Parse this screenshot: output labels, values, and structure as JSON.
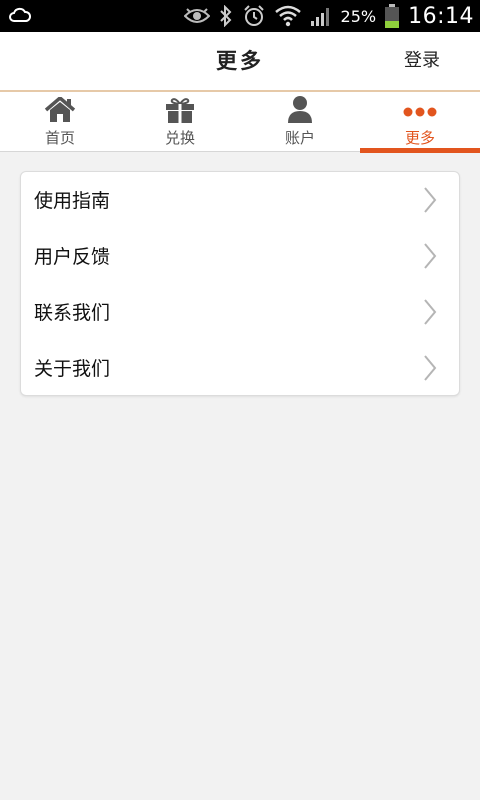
{
  "status_bar": {
    "battery_percent": "25%",
    "time": "16:14"
  },
  "header": {
    "title": "更多",
    "login_label": "登录"
  },
  "tabs": [
    {
      "label": "首页",
      "icon": "home-icon",
      "active": false
    },
    {
      "label": "兑换",
      "icon": "gift-icon",
      "active": false
    },
    {
      "label": "账户",
      "icon": "user-icon",
      "active": false
    },
    {
      "label": "更多",
      "icon": "more-dots-icon",
      "active": true
    }
  ],
  "menu": {
    "items": [
      {
        "label": "使用指南"
      },
      {
        "label": "用户反馈"
      },
      {
        "label": "联系我们"
      },
      {
        "label": "关于我们"
      }
    ]
  },
  "colors": {
    "accent": "#e2551e",
    "tab_icon": "#555555",
    "header_divider": "#e6c9a8"
  }
}
